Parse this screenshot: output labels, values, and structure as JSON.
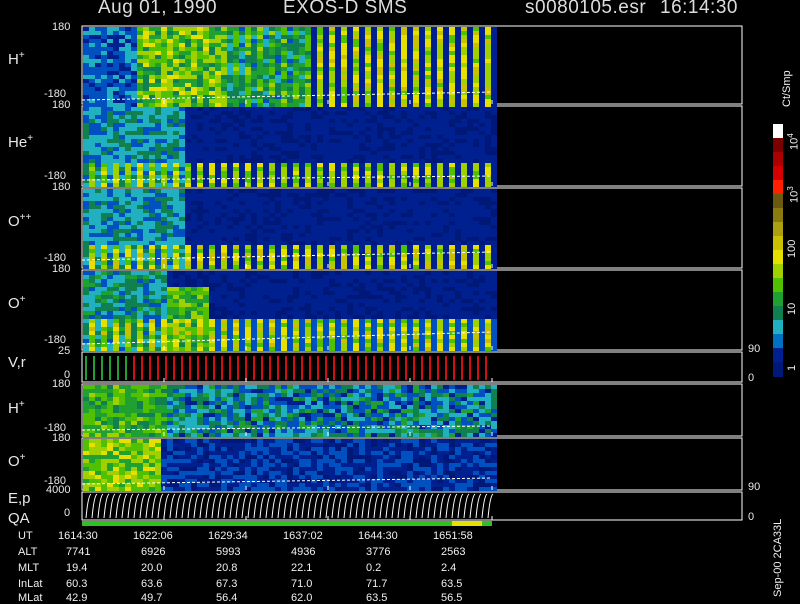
{
  "header": {
    "date": "Aug 01, 1990",
    "instrument": "EXOS-D SMS",
    "file": "s0080105.esr",
    "time": "16:14:30"
  },
  "panels": [
    {
      "species": "H",
      "charge": "+",
      "top": "180",
      "bottom": "-180"
    },
    {
      "species": "He",
      "charge": "+",
      "top": "180",
      "bottom": "-180"
    },
    {
      "species": "O",
      "charge": "++",
      "top": "180",
      "bottom": "-180"
    },
    {
      "species": "O",
      "charge": "+",
      "top": "180",
      "bottom": "-180"
    },
    {
      "label": "V,r",
      "top": "25",
      "bottom": "0",
      "right_top": "90",
      "right_bottom": "0"
    },
    {
      "species": "H",
      "charge": "+",
      "top": "180",
      "bottom": "-180"
    },
    {
      "species": "O",
      "charge": "+",
      "top": "180",
      "bottom": "-180"
    },
    {
      "label": "E,p",
      "top": "4000",
      "bottom": "0",
      "right_top": "90",
      "right_bottom": "0"
    }
  ],
  "qa_label": "QA",
  "colorbar": {
    "title": "Ct/Smp",
    "labels": [
      "10",
      "4",
      "10",
      "3",
      "100",
      "10",
      "1"
    ],
    "colors": [
      "#ffffff",
      "#7a0000",
      "#aa0000",
      "#d40000",
      "#ff2000",
      "#6a5a10",
      "#8a7a10",
      "#aaa010",
      "#c8c000",
      "#e6e000",
      "#a0d000",
      "#50c000",
      "#20a030",
      "#108050",
      "#20b0c0",
      "#0070c0",
      "#002090",
      "#001878"
    ]
  },
  "footer": {
    "row_labels": [
      "UT",
      "ALT",
      "MLT",
      "InLat",
      "MLat"
    ],
    "columns": [
      {
        "UT": "1614:30",
        "ALT": "7741",
        "MLT": "19.4",
        "InLat": "60.3",
        "MLat": "42.9"
      },
      {
        "UT": "1622:06",
        "ALT": "6926",
        "MLT": "20.0",
        "InLat": "63.6",
        "MLat": "49.7"
      },
      {
        "UT": "1629:34",
        "ALT": "5993",
        "MLT": "20.8",
        "InLat": "67.3",
        "MLat": "56.4"
      },
      {
        "UT": "1637:02",
        "ALT": "4936",
        "MLT": "22.1",
        "InLat": "71.0",
        "MLat": "62.0"
      },
      {
        "UT": "1644:30",
        "ALT": "3776",
        "MLT": "0.2",
        "InLat": "71.7",
        "MLat": "63.5"
      },
      {
        "UT": "1651:58",
        "ALT": "2563",
        "MLT": "2.4",
        "InLat": "63.5",
        "MLat": "56.5"
      }
    ],
    "stamp": "Sep-00  2CA33L"
  },
  "chart_data": {
    "type": "heatmap",
    "title": "Aug 01, 1990   EXOS-D SMS",
    "x_ticks": [
      "1614:30",
      "1622:06",
      "1629:34",
      "1637:02",
      "1644:30",
      "1651:58"
    ],
    "x_data_fraction": 0.552,
    "panels": [
      {
        "name": "H+",
        "ylim": [
          -180,
          180
        ],
        "kind": "pitch-angle spectrogram"
      },
      {
        "name": "He+",
        "ylim": [
          -180,
          180
        ],
        "kind": "pitch-angle spectrogram"
      },
      {
        "name": "O++",
        "ylim": [
          -180,
          180
        ],
        "kind": "pitch-angle spectrogram"
      },
      {
        "name": "O+",
        "ylim": [
          -180,
          180
        ],
        "kind": "pitch-angle spectrogram"
      },
      {
        "name": "V,r",
        "ylim": [
          0,
          25
        ],
        "ylim_right": [
          0,
          90
        ]
      },
      {
        "name": "H+",
        "ylim": [
          -180,
          180
        ],
        "kind": "spectrogram"
      },
      {
        "name": "O+",
        "ylim": [
          -180,
          180
        ],
        "kind": "spectrogram"
      },
      {
        "name": "E,p",
        "ylim": [
          0,
          4000
        ],
        "ylim_right": [
          0,
          90
        ]
      }
    ],
    "colorbar": {
      "label": "Ct/Smp",
      "scale": "log",
      "range": [
        1,
        10000
      ]
    }
  }
}
